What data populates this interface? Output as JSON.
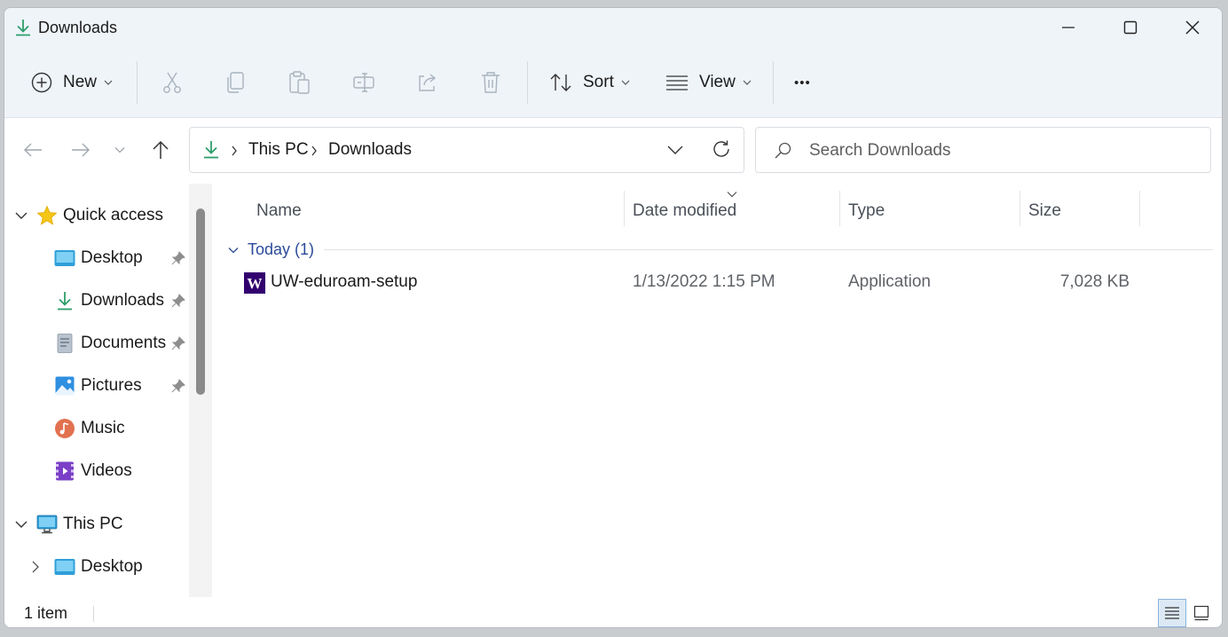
{
  "window": {
    "title": "Downloads"
  },
  "toolbar": {
    "new_label": "New",
    "sort_label": "Sort",
    "view_label": "View",
    "more_label": "•••"
  },
  "address": {
    "crumbs": [
      "This PC",
      "Downloads"
    ]
  },
  "search": {
    "placeholder": "Search Downloads"
  },
  "sidebar": {
    "quick_access": "Quick access",
    "items": [
      {
        "label": "Desktop",
        "pinned": true
      },
      {
        "label": "Downloads",
        "pinned": true
      },
      {
        "label": "Documents",
        "pinned": true
      },
      {
        "label": "Pictures",
        "pinned": true
      },
      {
        "label": "Music",
        "pinned": false
      },
      {
        "label": "Videos",
        "pinned": false
      }
    ],
    "this_pc": "This PC",
    "this_pc_items": [
      {
        "label": "Desktop"
      }
    ]
  },
  "columns": {
    "name": "Name",
    "date": "Date modified",
    "type": "Type",
    "size": "Size"
  },
  "groups": [
    {
      "label": "Today (1)",
      "files": [
        {
          "name": "UW-eduroam-setup",
          "date": "1/13/2022 1:15 PM",
          "type": "Application",
          "size": "7,028 KB",
          "icon": "W"
        }
      ]
    }
  ],
  "status": {
    "count": "1 item"
  },
  "colors": {
    "accent_green": "#2e9e6b",
    "group_blue": "#2b4a9a",
    "uw_purple": "#32006e"
  }
}
